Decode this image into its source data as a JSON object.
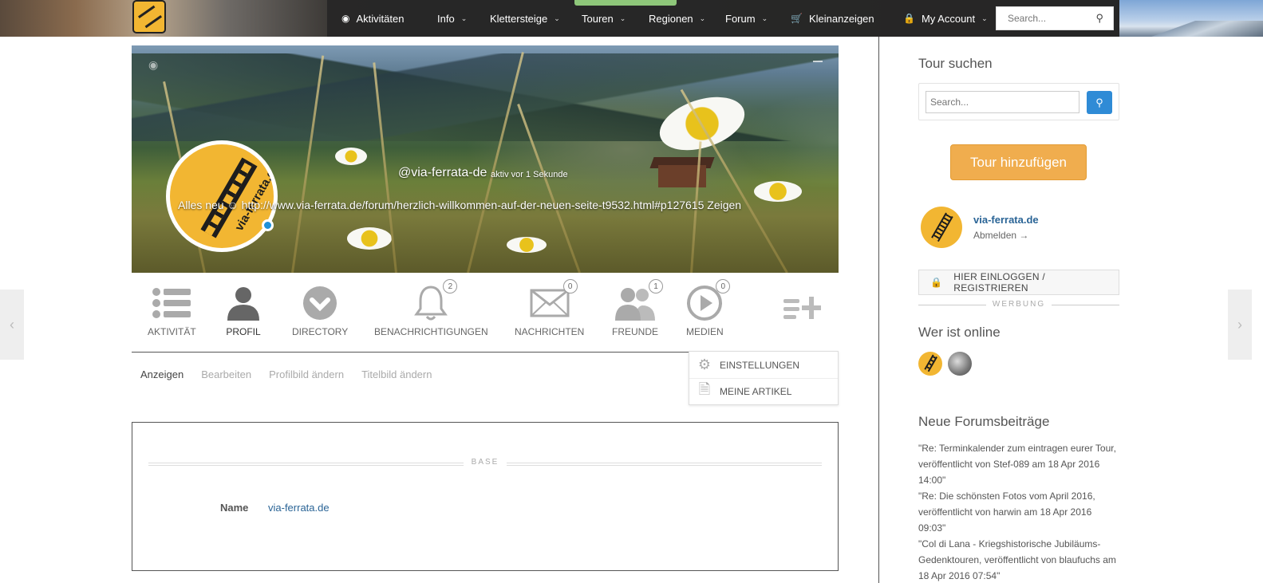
{
  "nav": {
    "items": [
      {
        "label": "Aktivitäten",
        "icon": "camera-icon"
      },
      {
        "label": "Info",
        "dropdown": true
      },
      {
        "label": "Klettersteige",
        "dropdown": true
      },
      {
        "label": "Touren",
        "dropdown": true
      },
      {
        "label": "Regionen",
        "dropdown": true
      },
      {
        "label": "Forum",
        "dropdown": true
      },
      {
        "label": "Kleinanzeigen",
        "icon": "cart-icon"
      },
      {
        "label": "My Account",
        "icon": "lock-icon",
        "dropdown": true
      }
    ],
    "search_placeholder": "Search..."
  },
  "profile": {
    "handle": "@via-ferrata-de",
    "active_since": "aktiv vor 1 Sekunde",
    "status": "Alles neu ☺ http://www.via-ferrata.de/forum/herzlich-willkommen-auf-der-neuen-seite-t9532.html#p127615 Zeigen",
    "avatar_brand": "via-ferrata.de"
  },
  "tabs": [
    {
      "label": "AKTIVITÄT",
      "icon": "list-icon"
    },
    {
      "label": "PROFIL",
      "icon": "person-icon",
      "active": true
    },
    {
      "label": "DIRECTORY",
      "icon": "chevron-circle-icon"
    },
    {
      "label": "BENACHRICHTIGUNGEN",
      "icon": "bell-icon",
      "count": "2"
    },
    {
      "label": "NACHRICHTEN",
      "icon": "envelope-icon",
      "count": "0"
    },
    {
      "label": "FREUNDE",
      "icon": "friends-icon",
      "count": "1"
    },
    {
      "label": "MEDIEN",
      "icon": "play-icon",
      "count": "0"
    }
  ],
  "subnav": [
    "Anzeigen",
    "Bearbeiten",
    "Profilbild ändern",
    "Titelbild ändern"
  ],
  "dropdown": [
    {
      "label": "EINSTELLUNGEN",
      "icon": "gear-icon"
    },
    {
      "label": "MEINE ARTIKEL",
      "icon": "document-icon"
    }
  ],
  "base": {
    "title": "BASE",
    "name_label": "Name",
    "name_value": "via-ferrata.de"
  },
  "sidebar": {
    "tour_search_title": "Tour suchen",
    "search_placeholder": "Search...",
    "add_tour": "Tour hinzufügen",
    "user_name": "via-ferrata.de",
    "logout": "Abmelden →",
    "login": "HIER EINLOGGEN / REGISTRIEREN",
    "ad_label": "WERBUNG",
    "online_title": "Wer ist online",
    "forum_title": "Neue Forumsbeiträge",
    "posts": [
      "\"Re: Terminkalender zum eintragen eurer Tour, veröffentlicht von Stef-089 am 18 Apr 2016 14:00\"",
      "\"Re: Die schönsten Fotos vom April 2016, veröffentlicht von harwin am 18 Apr 2016 09:03\"",
      "\"Col di Lana - Kriegshistorische Jubiläums-Gedenktouren, veröffentlicht von blaufuchs am 18 Apr 2016 07:54\""
    ]
  },
  "colors": {
    "accent": "#f0ad4e",
    "link": "#2a6496",
    "brand": "#f2b632",
    "search_button": "#2f8bd6"
  }
}
